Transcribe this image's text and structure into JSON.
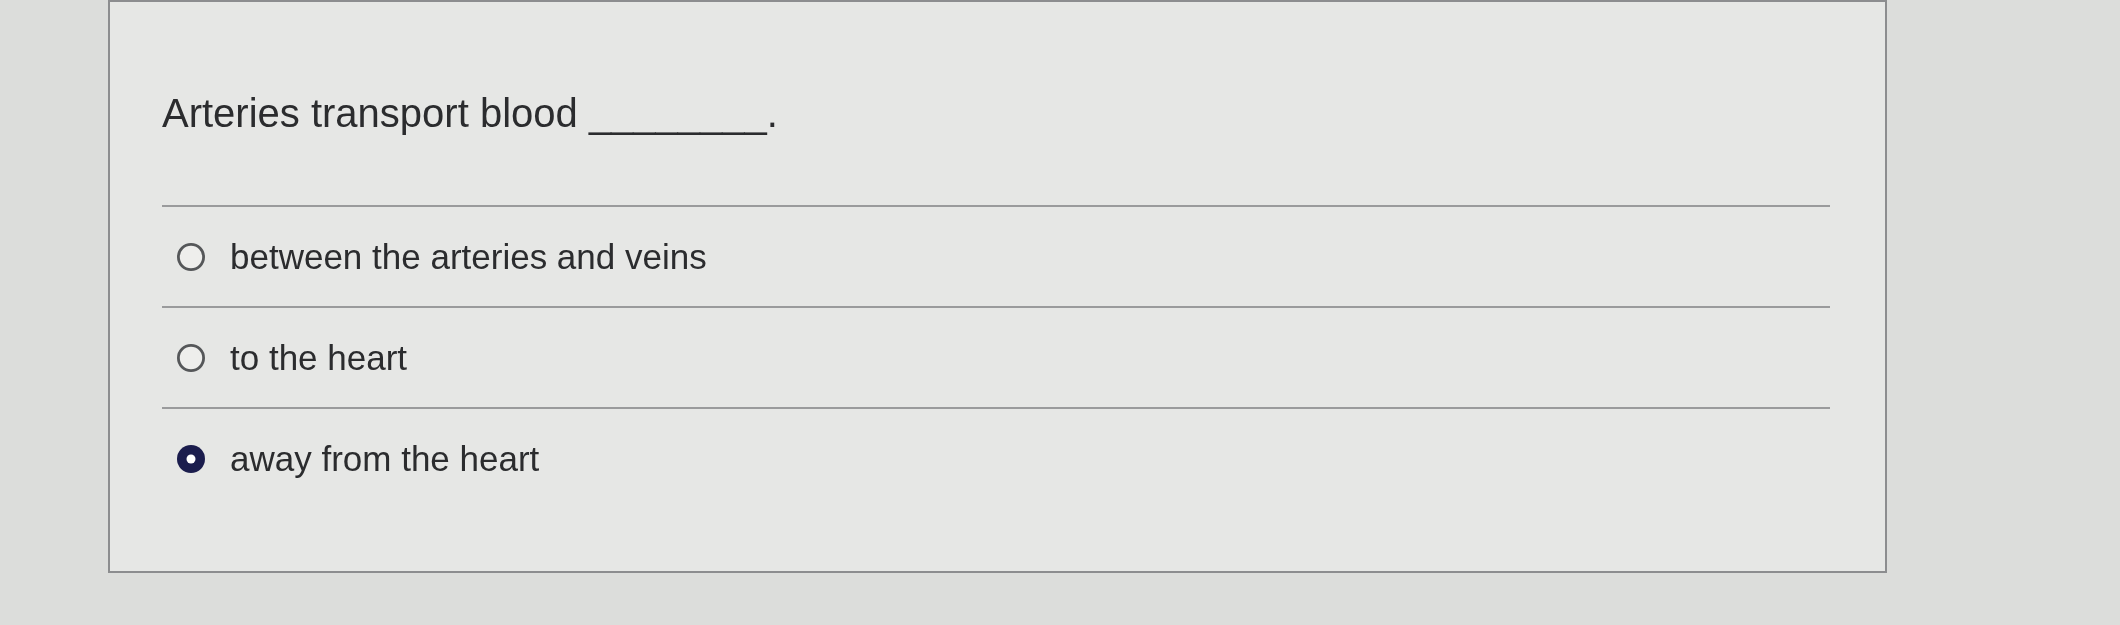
{
  "question": {
    "text": "Arteries transport blood ________."
  },
  "options": [
    {
      "label": "between the arteries and veins",
      "selected": false
    },
    {
      "label": "to the heart",
      "selected": false
    },
    {
      "label": "away from the heart",
      "selected": true
    }
  ]
}
